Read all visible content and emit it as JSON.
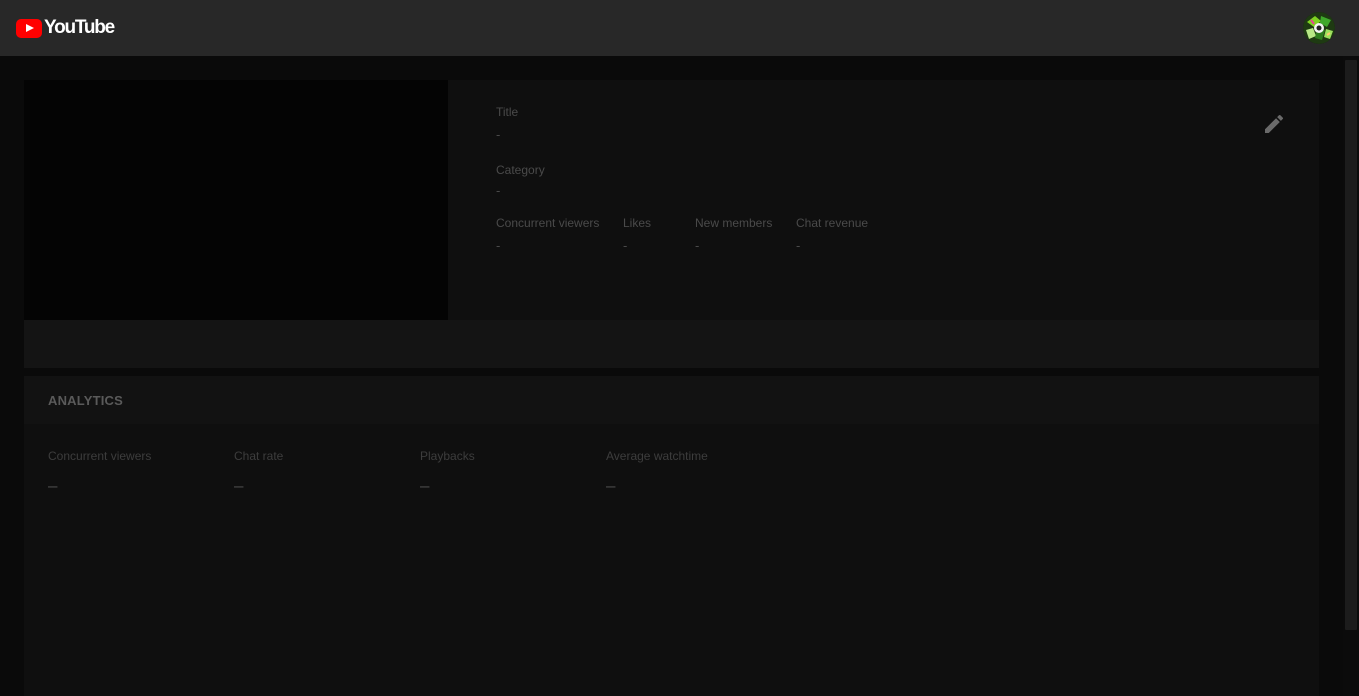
{
  "header": {
    "logo_text": "YouTube",
    "logo_icon": "youtube-play-icon",
    "avatar_icon": "user-avatar",
    "brand_color": "#ff0000"
  },
  "stream": {
    "title_label": "Title",
    "title_value": "-",
    "category_label": "Category",
    "category_value": "-",
    "stats": [
      {
        "label": "Concurrent viewers",
        "value": "-"
      },
      {
        "label": "Likes",
        "value": "-"
      },
      {
        "label": "New members",
        "value": "-"
      },
      {
        "label": "Chat revenue",
        "value": "-"
      }
    ],
    "edit_icon": "pencil-icon"
  },
  "analytics": {
    "title": "ANALYTICS",
    "metrics": [
      {
        "label": "Concurrent viewers",
        "value": "–"
      },
      {
        "label": "Chat rate",
        "value": "–"
      },
      {
        "label": "Playbacks",
        "value": "–"
      },
      {
        "label": "Average watchtime",
        "value": "–"
      }
    ]
  }
}
